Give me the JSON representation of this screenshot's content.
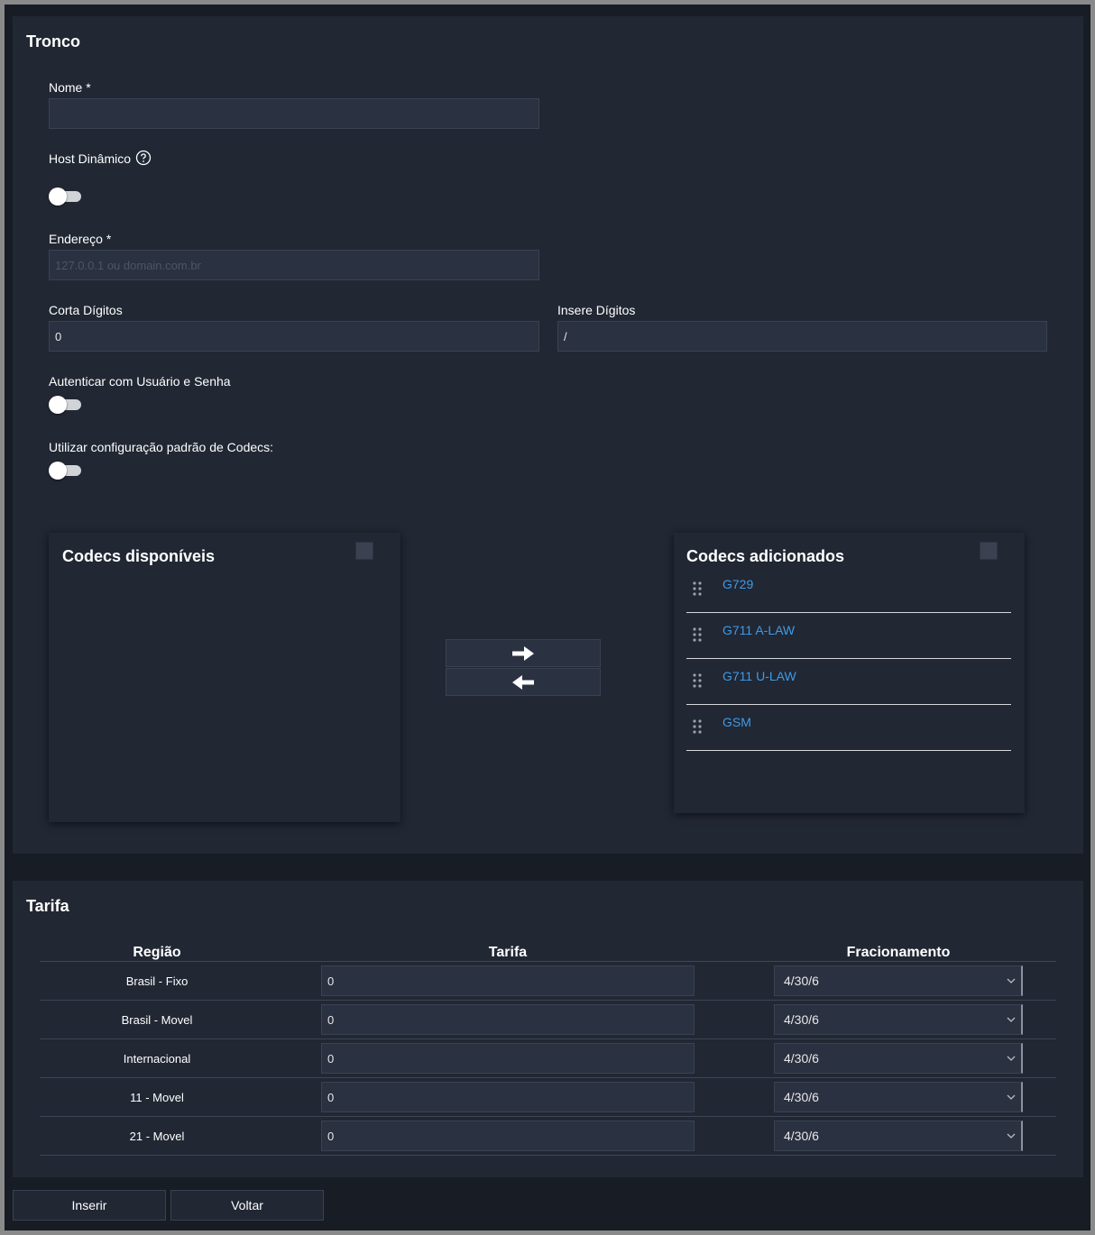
{
  "tronco": {
    "title": "Tronco",
    "nome_label": "Nome *",
    "nome_value": "",
    "host_label": "Host Dinâmico",
    "endereco_label": "Endereço *",
    "endereco_placeholder": "127.0.0.1 ou domain.com.br",
    "corta_label": "Corta Dígitos",
    "corta_value": "0",
    "insere_label": "Insere Dígitos",
    "insere_value": "/",
    "auth_label": "Autenticar com Usuário e Senha",
    "codecs_default_label": "Utilizar configuração padrão de Codecs:"
  },
  "codecs": {
    "available_title": "Codecs disponíveis",
    "added_title": "Codecs adicionados",
    "added": [
      "G729",
      "G711 A-LAW",
      "G711 U-LAW",
      "GSM"
    ]
  },
  "tarifa": {
    "title": "Tarifa",
    "headers": [
      "Região",
      "Tarifa",
      "Fracionamento"
    ],
    "rows": [
      {
        "regiao": "Brasil - Fixo",
        "tarifa": "0",
        "fracionamento": "4/30/6"
      },
      {
        "regiao": "Brasil - Movel",
        "tarifa": "0",
        "fracionamento": "4/30/6"
      },
      {
        "regiao": "Internacional",
        "tarifa": "0",
        "fracionamento": "4/30/6"
      },
      {
        "regiao": "11 - Movel",
        "tarifa": "0",
        "fracionamento": "4/30/6"
      },
      {
        "regiao": "21 - Movel",
        "tarifa": "0",
        "fracionamento": "4/30/6"
      }
    ]
  },
  "footer": {
    "insert_label": "Inserir",
    "back_label": "Voltar"
  },
  "colors": {
    "link": "#3d9be9",
    "card": "#212733",
    "background": "#181c24"
  }
}
